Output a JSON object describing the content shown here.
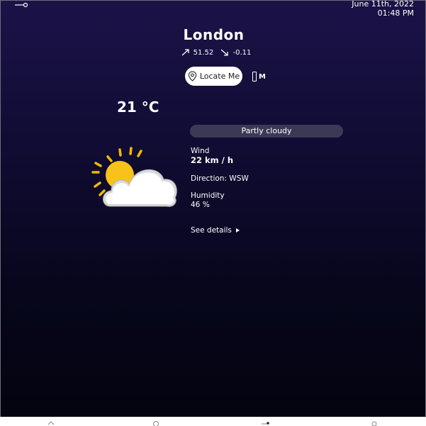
{
  "datetime": {
    "date": "June 11th, 2022",
    "time": "01:48 PM"
  },
  "location": {
    "city": "London",
    "latitude": "51.52",
    "longitude": "-0.11",
    "locate_label": "Locate Me",
    "unit_label": "M"
  },
  "weather": {
    "temperature": "21 °C",
    "condition": "Partly cloudy",
    "icon": "partly-cloudy-sun-icon",
    "wind_label": "Wind",
    "wind_value": "22 km / h",
    "direction": "Direction: WSW",
    "humidity_label": "Humidity",
    "humidity_value": "46 %",
    "see_details_label": "See details"
  },
  "colors": {
    "background_top": "#1b1348",
    "background_bottom": "#04040f",
    "condition_pill": "#3a3a55",
    "sun": "#f5b800"
  },
  "nav": {
    "items": [
      "home-icon",
      "search-icon",
      "dashboard-icon",
      "profile-icon"
    ],
    "active_index": 2
  }
}
